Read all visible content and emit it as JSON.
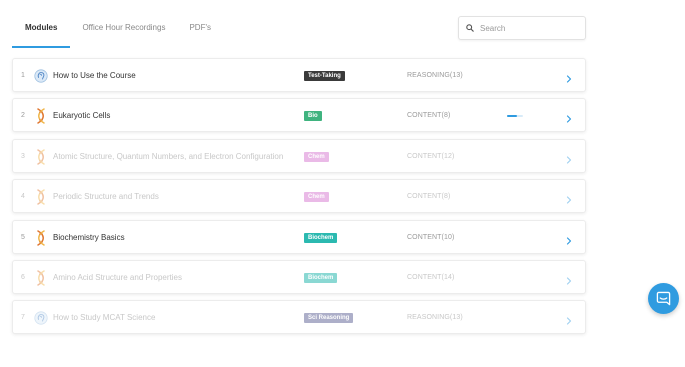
{
  "tabs": [
    {
      "label": "Modules",
      "active": true
    },
    {
      "label": "Office Hour Recordings",
      "active": false
    },
    {
      "label": "PDF's",
      "active": false
    }
  ],
  "search": {
    "placeholder": "Search",
    "value": ""
  },
  "tag_colors": {
    "Test-Taking": "#3a3a3a",
    "Bio": "#3fb37f",
    "Chem": "#d982d4",
    "Biochem": "#2bb9b0",
    "Sci Reasoning": "#6b6f9e"
  },
  "modules": [
    {
      "num": "1",
      "icon": "brain-icon",
      "title": "How to Use the Course",
      "tag": "Test-Taking",
      "category": "REASONING(13)",
      "dimmed": false,
      "progress": null
    },
    {
      "num": "2",
      "icon": "dna-icon",
      "title": "Eukaryotic Cells",
      "tag": "Bio",
      "category": "CONTENT(8)",
      "dimmed": false,
      "progress": 0.6
    },
    {
      "num": "3",
      "icon": "dna-icon",
      "title": "Atomic Structure, Quantum Numbers, and Electron Configuration",
      "tag": "Chem",
      "category": "CONTENT(12)",
      "dimmed": true,
      "progress": null
    },
    {
      "num": "4",
      "icon": "dna-icon",
      "title": "Periodic Structure and Trends",
      "tag": "Chem",
      "category": "CONTENT(8)",
      "dimmed": true,
      "progress": null
    },
    {
      "num": "5",
      "icon": "dna-icon",
      "title": "Biochemistry Basics",
      "tag": "Biochem",
      "category": "CONTENT(10)",
      "dimmed": false,
      "progress": null
    },
    {
      "num": "6",
      "icon": "dna-icon",
      "title": "Amino Acid Structure and Properties",
      "tag": "Biochem",
      "category": "CONTENT(14)",
      "dimmed": true,
      "progress": null
    },
    {
      "num": "7",
      "icon": "brain-icon",
      "title": "How to Study MCAT Science",
      "tag": "Sci Reasoning",
      "category": "REASONING(13)",
      "dimmed": true,
      "progress": null
    }
  ],
  "chat": {
    "icon": "chat-bubble-icon"
  }
}
